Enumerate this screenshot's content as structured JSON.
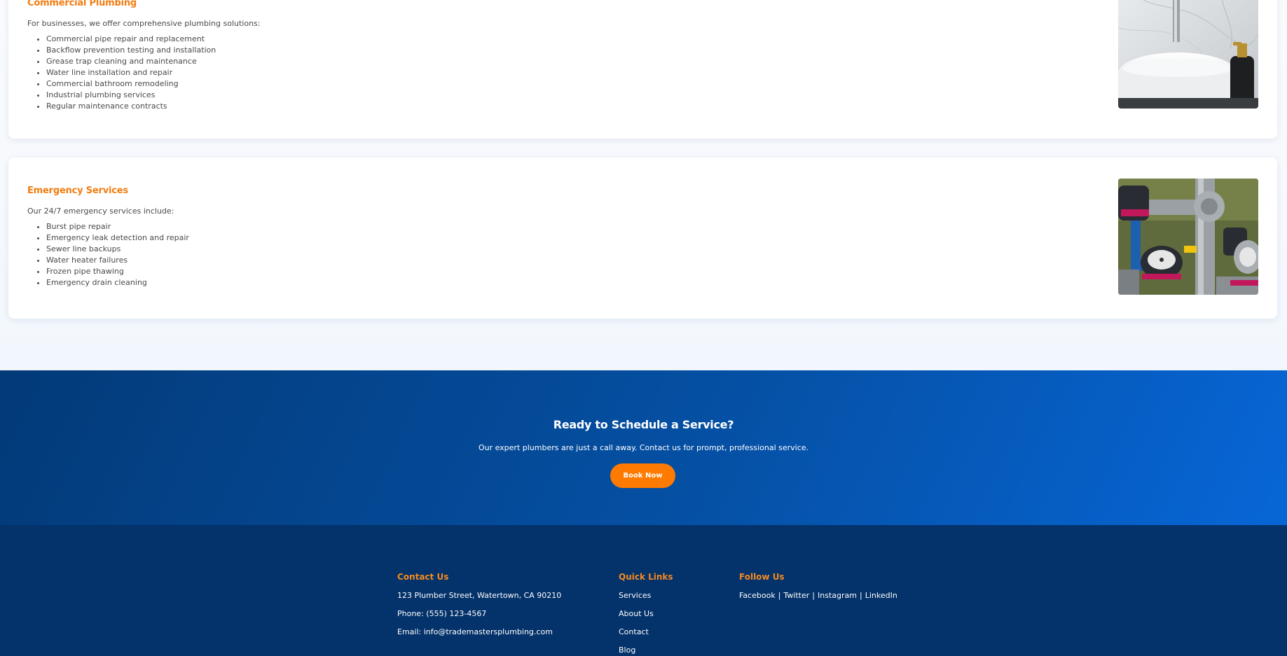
{
  "services": {
    "commercial": {
      "title": "Commercial Plumbing",
      "intro": "For businesses, we offer comprehensive plumbing solutions:",
      "items": [
        "Commercial pipe repair and replacement",
        "Backflow prevention testing and installation",
        "Grease trap cleaning and maintenance",
        "Water line installation and repair",
        "Commercial bathroom remodeling",
        "Industrial plumbing services",
        "Regular maintenance contracts"
      ]
    },
    "emergency": {
      "title": "Emergency Services",
      "intro": "Our 24/7 emergency services include:",
      "items": [
        "Burst pipe repair",
        "Emergency leak detection and repair",
        "Sewer line backups",
        "Water heater failures",
        "Frozen pipe thawing",
        "Emergency drain cleaning"
      ]
    }
  },
  "cta": {
    "title": "Ready to Schedule a Service?",
    "text": "Our expert plumbers are just a call away. Contact us for prompt, professional service.",
    "button_label": "Book Now"
  },
  "footer": {
    "contact": {
      "heading": "Contact Us",
      "address": "123 Plumber Street, Watertown, CA 90210",
      "phone": "Phone: (555) 123-4567",
      "email": "Email: info@trademastersplumbing.com"
    },
    "quick_links": {
      "heading": "Quick Links",
      "items": [
        "Services",
        "About Us",
        "Contact",
        "Blog"
      ]
    },
    "follow": {
      "heading": "Follow Us",
      "items": [
        "Facebook",
        "Twitter",
        "Instagram",
        "LinkedIn"
      ],
      "separator": "|"
    }
  },
  "colors": {
    "accent": "#f27d12",
    "button": "#ff7a00",
    "cta_gradient_start": "#033a78",
    "cta_gradient_end": "#0766d6",
    "footer_bg": "#04326a"
  }
}
